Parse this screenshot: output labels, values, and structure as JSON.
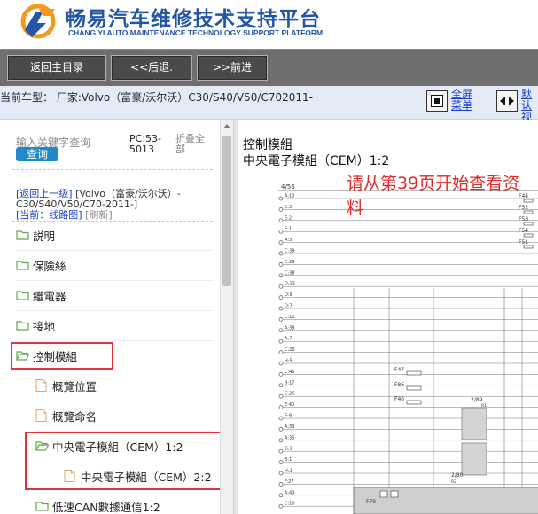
{
  "header": {
    "title": "畅易汽车维修技术支持平台",
    "subtitle": "CHANG YI AUTO MAINTENANCE TECHNOLOGY SUPPORT PLATFORM",
    "brand_color": "#2456a6"
  },
  "nav": {
    "back_to_main": "返回主目录",
    "back": "<<后退.",
    ">>forward": ">>前进",
    "forward": ">>前进"
  },
  "car_bar": {
    "current_model": "当前车型：  厂家:Volvo（富豪/沃尔沃）C30/S40/V50/C702011-",
    "fullscreen_label_1": "全屏",
    "fullscreen_label_2": "菜单",
    "default_view_label_1": "默认",
    "default_view_label_2": "视图"
  },
  "sidebar": {
    "search_placeholder": "输入关键字查询",
    "query_button": "查询",
    "pc_code_1": "PC:53-",
    "pc_code_2": "5013",
    "collapse_all_1": "折叠全",
    "collapse_all_2": "部",
    "back_up": "[返回上一级]",
    "path_model": "[Volvo（富豪/沃尔沃）-",
    "path_model_2": "C30/S40/V50/C70-2011-]",
    "current_prefix": "[当前：",
    "current_name": "线路图]",
    "refresh": "[刷新]",
    "items": [
      {
        "label": "説明",
        "type": "folder"
      },
      {
        "label": "保險絲",
        "type": "folder"
      },
      {
        "label": "繼電器",
        "type": "folder"
      },
      {
        "label": "接地",
        "type": "folder"
      },
      {
        "label": "控制模組",
        "type": "folder-open"
      },
      {
        "label": "概覽位置",
        "type": "doc"
      },
      {
        "label": "概覽命名",
        "type": "doc"
      },
      {
        "label": "中央電子模組（CEM）1:2",
        "type": "folder-open"
      },
      {
        "label": "中央電子模組（CEM）2:2",
        "type": "doc"
      },
      {
        "label": "低速CAN數據通信1:2",
        "type": "folder"
      }
    ],
    "highlight_color": "#e0333a"
  },
  "content": {
    "title": "控制模組",
    "subtitle": "中央電子模組（CEM）1:2",
    "note": "请从第39页开始查看资料",
    "note_color": "#e02a2a"
  },
  "diagram": {
    "page_label": "4/56",
    "left_pins": [
      "A:10",
      "E:3",
      "E:2",
      "E:1",
      "A:3",
      "C:39",
      "C:29",
      "C:38",
      "D:12",
      "D:9",
      "D:7",
      "C:11",
      "A:38",
      "A:7",
      "C:20",
      "H:5",
      "C:45",
      "B:17",
      "C:26",
      "E:40",
      "E:9",
      "A:33",
      "A:35",
      "G:1",
      "B:1",
      "H:2",
      "F:27",
      "A:40",
      "C:10"
    ],
    "right_fuses": [
      "F44",
      "F52",
      "F53",
      "F54",
      "F51"
    ],
    "inline_fuses": [
      "F47",
      "F86",
      "F46",
      "F79"
    ],
    "relay_labels": [
      "2/89",
      "R1",
      "2/80",
      "R2"
    ]
  }
}
